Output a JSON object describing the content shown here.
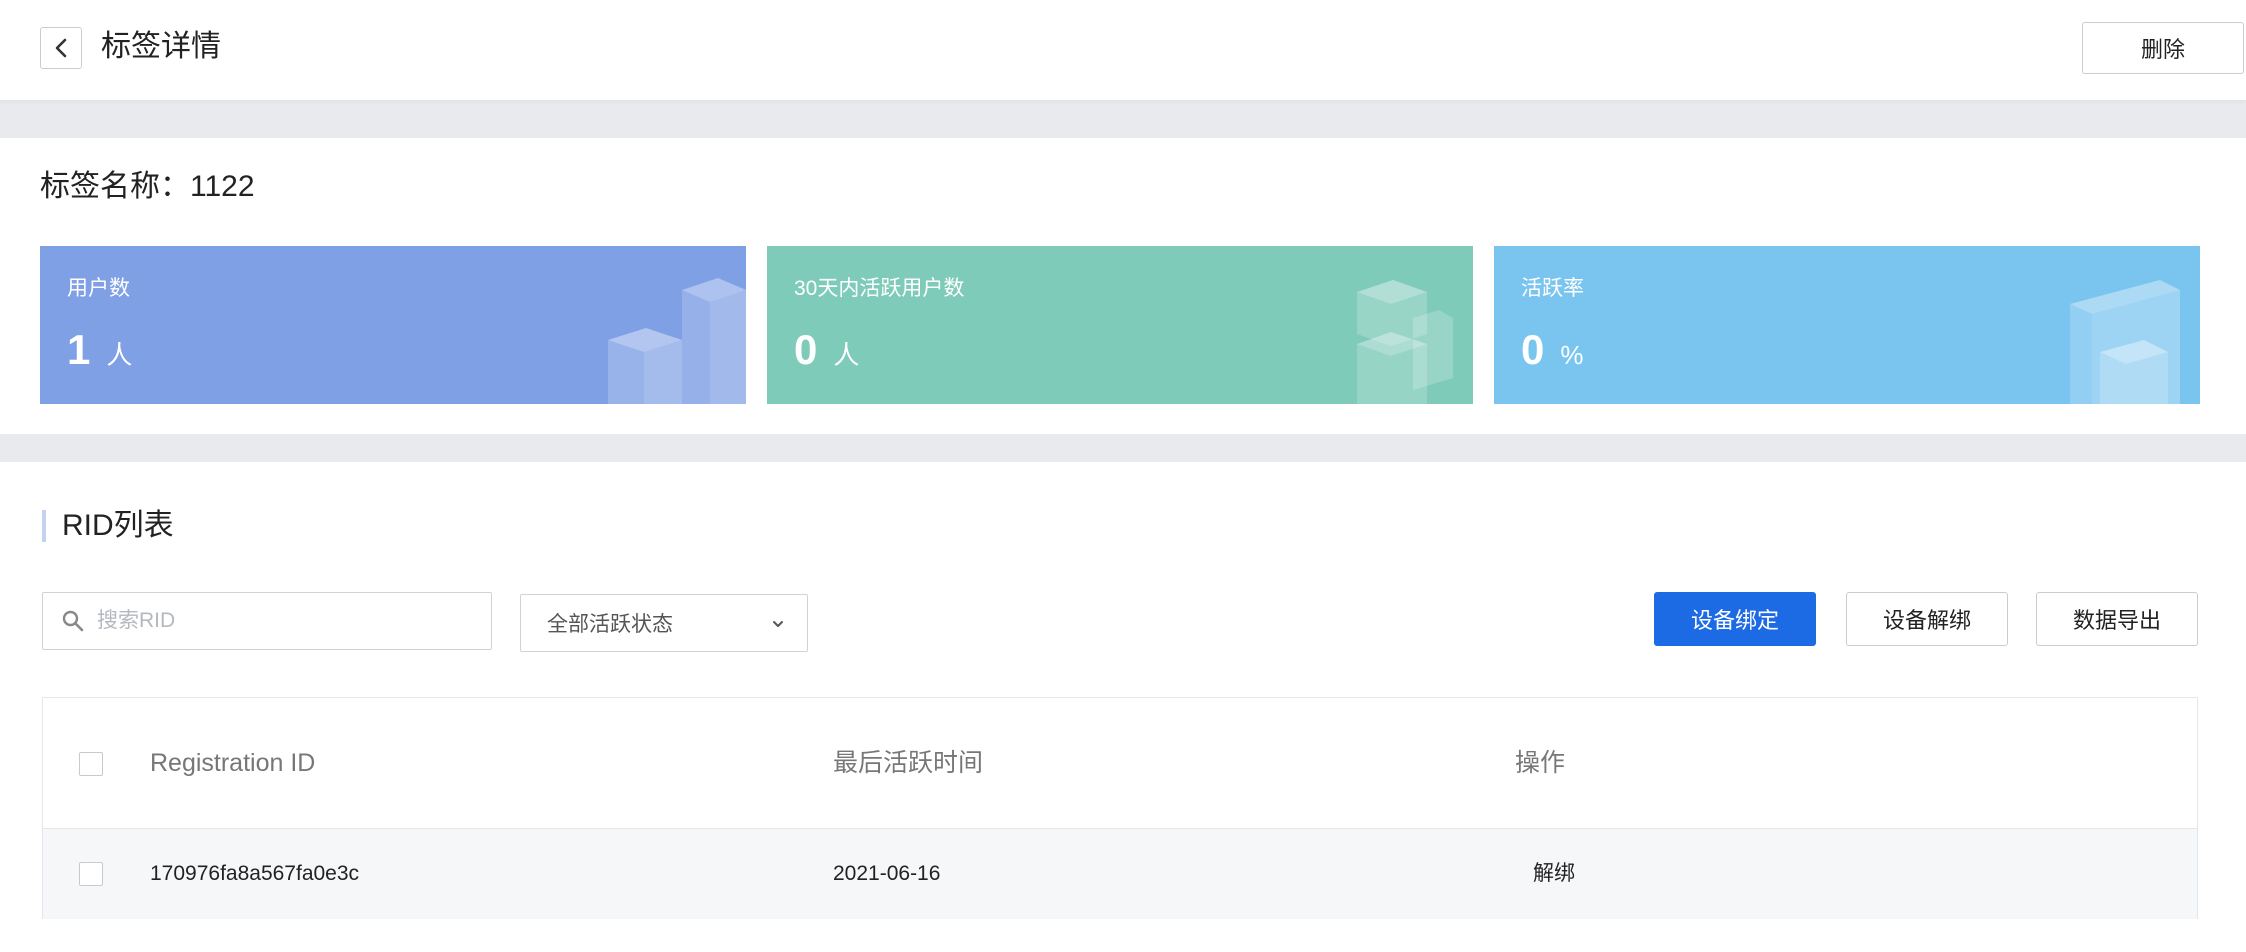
{
  "header": {
    "title": "标签详情",
    "delete_label": "删除"
  },
  "tag": {
    "name_label": "标签名称：",
    "name_value": "1122"
  },
  "stats": [
    {
      "label": "用户数",
      "value": "1",
      "unit": "人",
      "color": "#7fa0e5"
    },
    {
      "label": "30天内活跃用户数",
      "value": "0",
      "unit": "人",
      "color": "#7fcbba"
    },
    {
      "label": "活跃率",
      "value": "0",
      "unit": "%",
      "color": "#7ac5f0"
    }
  ],
  "rid_section": {
    "title": "RID列表",
    "search_placeholder": "搜索RID",
    "status_filter": "全部活跃状态",
    "buttons": {
      "bind": "设备绑定",
      "unbind": "设备解绑",
      "export": "数据导出"
    },
    "columns": {
      "registration_id": "Registration ID",
      "last_active": "最后活跃时间",
      "action": "操作"
    },
    "rows": [
      {
        "registration_id": "170976fa8a567fa0e3c",
        "last_active": "2021-06-16",
        "action": "解绑"
      }
    ]
  },
  "colors": {
    "primary": "#1d6ae5",
    "page_bg": "#e8eaed"
  }
}
